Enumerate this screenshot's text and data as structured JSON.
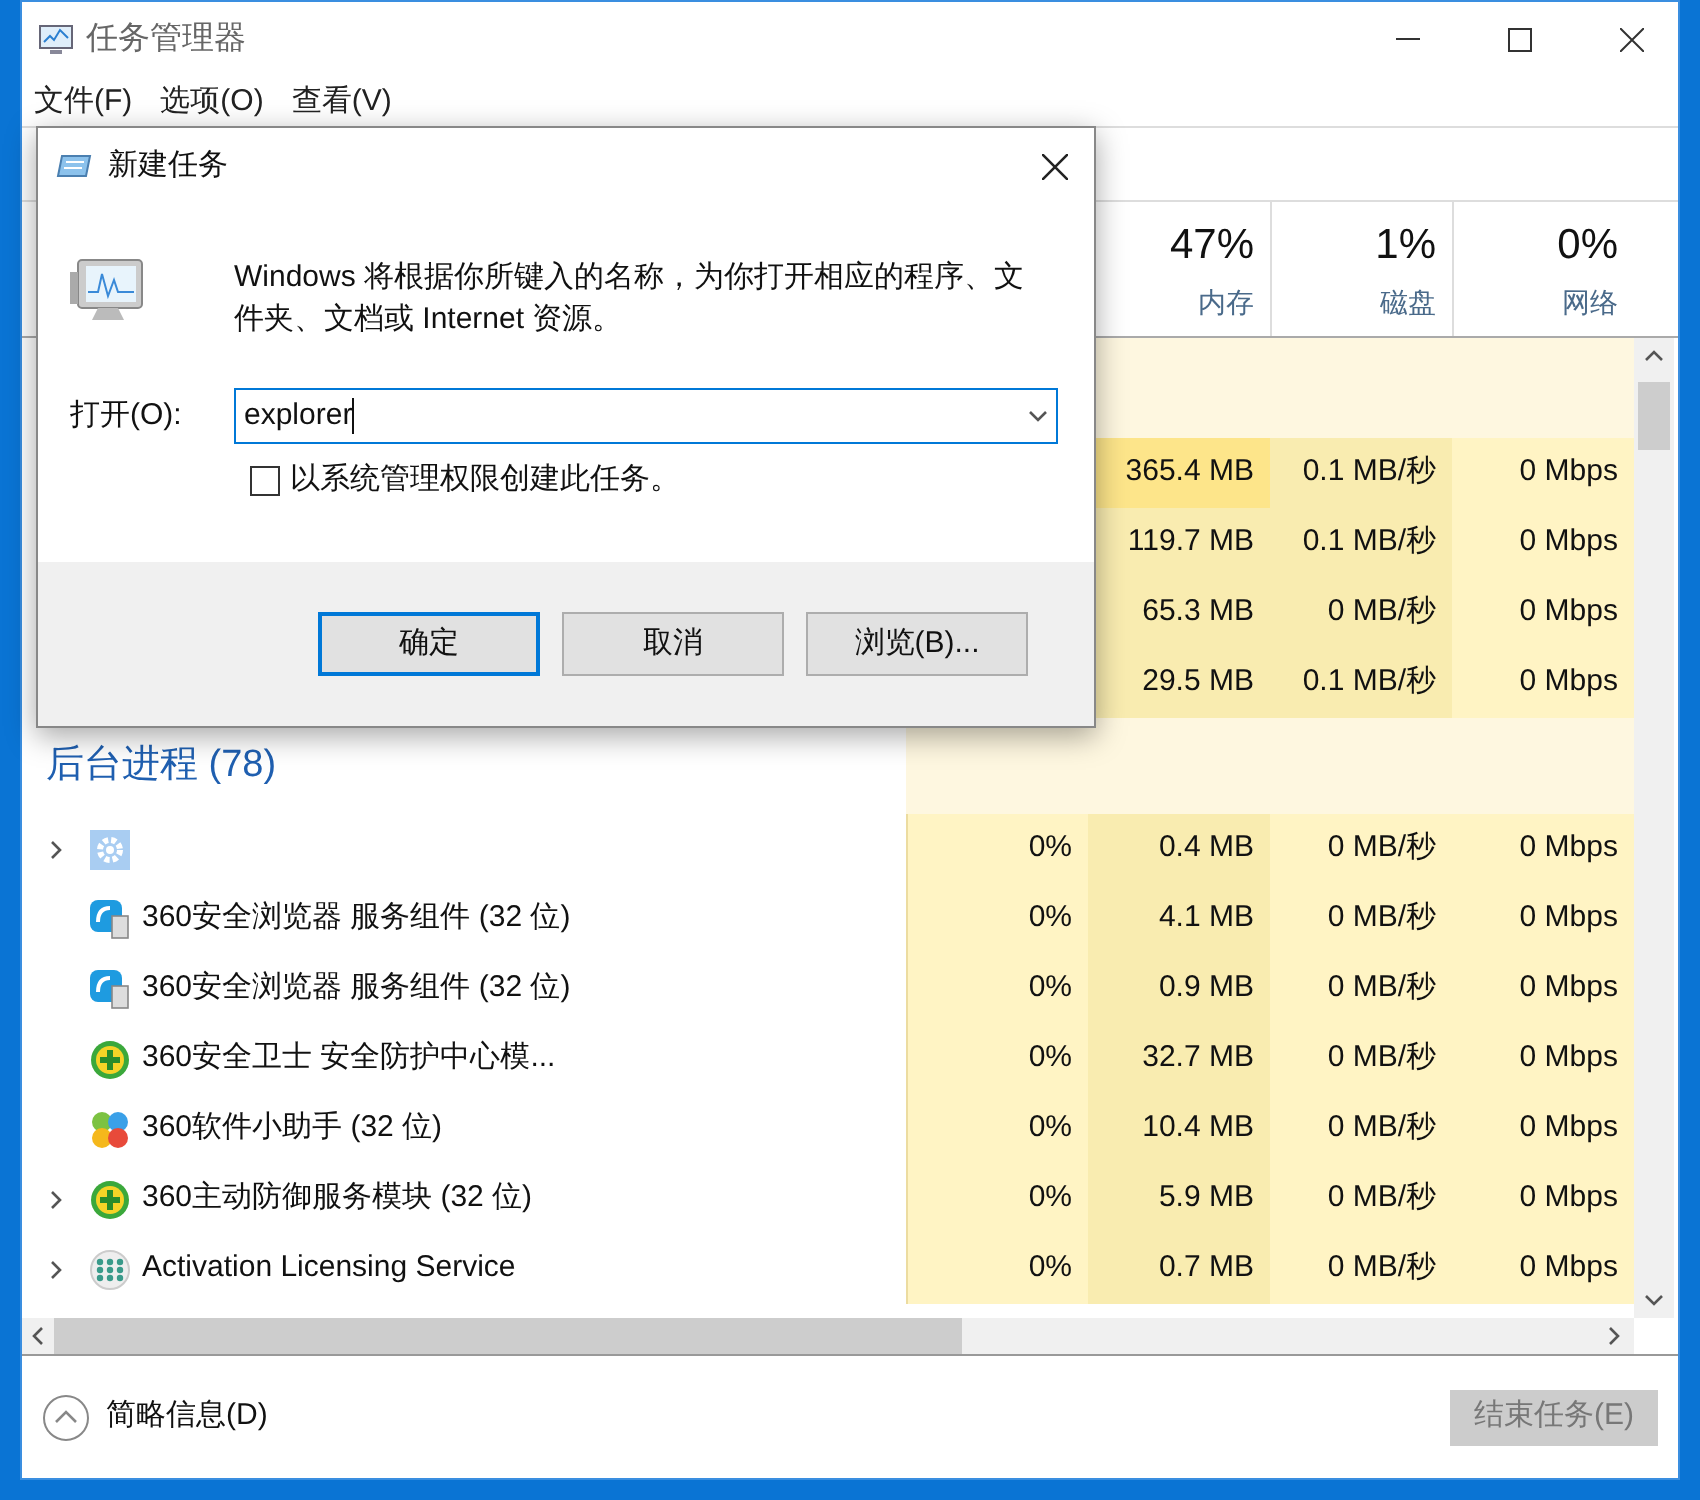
{
  "window": {
    "title": "任务管理器"
  },
  "menu": [
    "文件(F)",
    "选项(O)",
    "查看(V)"
  ],
  "columns": [
    {
      "value": "47%",
      "label": "内存"
    },
    {
      "value": "1%",
      "label": "磁盘"
    },
    {
      "value": "0%",
      "label": "网络"
    }
  ],
  "app_rows": [
    {
      "memory": "365.4 MB",
      "disk": "0.1 MB/秒",
      "network": "0 Mbps"
    },
    {
      "memory": "119.7 MB",
      "disk": "0.1 MB/秒",
      "network": "0 Mbps"
    },
    {
      "memory": "65.3 MB",
      "disk": "0 MB/秒",
      "network": "0 Mbps"
    },
    {
      "memory": "29.5 MB",
      "disk": "0.1 MB/秒",
      "network": "0 Mbps"
    }
  ],
  "background_group": {
    "title": "后台进程 (78)",
    "rows": [
      {
        "kind": "gear",
        "expandable": true,
        "cpu": "0%",
        "memory": "0.4 MB",
        "disk": "0 MB/秒",
        "network": "0 Mbps"
      },
      {
        "kind": "browser",
        "name": "360安全浏览器 服务组件 (32 位)",
        "expandable": false,
        "cpu": "0%",
        "memory": "4.1 MB",
        "disk": "0 MB/秒",
        "network": "0 Mbps"
      },
      {
        "kind": "browser",
        "name": "360安全浏览器 服务组件 (32 位)",
        "expandable": false,
        "cpu": "0%",
        "memory": "0.9 MB",
        "disk": "0 MB/秒",
        "network": "0 Mbps"
      },
      {
        "kind": "shield",
        "name": "360安全卫士 安全防护中心模...",
        "expandable": false,
        "cpu": "0%",
        "memory": "32.7 MB",
        "disk": "0 MB/秒",
        "network": "0 Mbps"
      },
      {
        "kind": "balls",
        "name": "360软件小助手 (32 位)",
        "expandable": false,
        "cpu": "0%",
        "memory": "10.4 MB",
        "disk": "0 MB/秒",
        "network": "0 Mbps"
      },
      {
        "kind": "shield",
        "name": "360主动防御服务模块 (32 位)",
        "expandable": true,
        "cpu": "0%",
        "memory": "5.9 MB",
        "disk": "0 MB/秒",
        "network": "0 Mbps"
      },
      {
        "kind": "dots",
        "name": "Activation Licensing Service",
        "expandable": true,
        "cpu": "0%",
        "memory": "0.7 MB",
        "disk": "0 MB/秒",
        "network": "0 Mbps"
      }
    ]
  },
  "footer": {
    "fewer_details": "简略信息(D)",
    "end_task": {
      "label": "结束任务(E)",
      "disabled": true
    }
  },
  "dialog": {
    "title": "新建任务",
    "message": "Windows 将根据你所键入的名称，为你打开相应的程序、文件夹、文档或 Internet 资源。",
    "open_label": "打开(O):",
    "value": "explorer",
    "admin_checkbox": {
      "label": "以系统管理权限创建此任务。",
      "checked": false
    },
    "buttons": [
      {
        "label": "确定",
        "default": true
      },
      {
        "label": "取消",
        "default": false
      },
      {
        "label": "浏览(B)...",
        "default": false
      }
    ]
  }
}
